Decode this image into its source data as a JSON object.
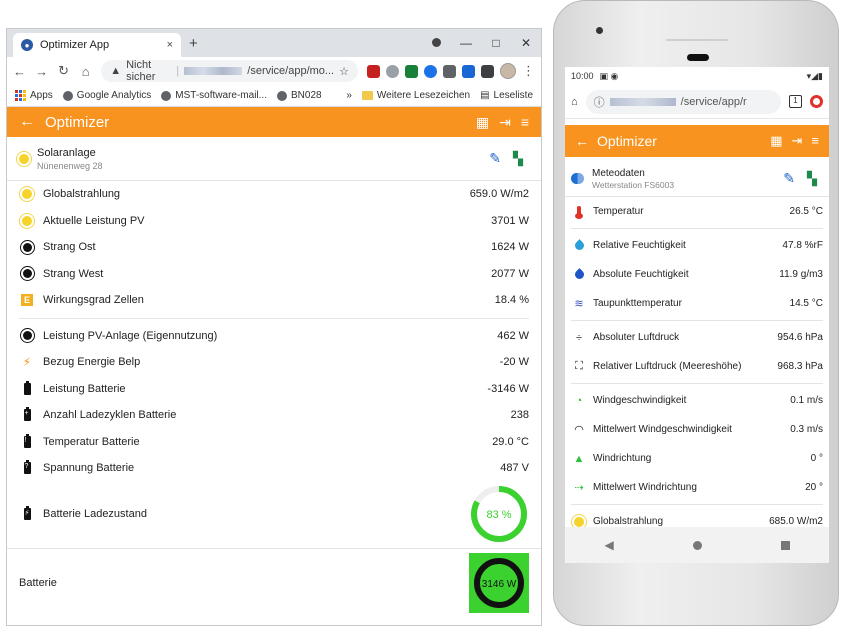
{
  "desktop": {
    "tab_title": "Optimizer App",
    "tab_close": "×",
    "new_tab": "+",
    "window_controls": [
      "—",
      "□",
      "✕"
    ],
    "url_warning": "Nicht sicher",
    "url_path": "/service/app/mo...",
    "bookmarks": {
      "apps": "Apps",
      "items": [
        "Google Analytics",
        "MST-software-mail...",
        "BN028"
      ],
      "more": "»",
      "other": "Weitere Lesezeichen",
      "reading": "Leseliste"
    },
    "appbar_title": "Optimizer",
    "panel_title": "Solaranlage",
    "panel_subtitle": "Nünenenweg 28",
    "rows_a": [
      {
        "icon": "sun-yellow-icon",
        "label": "Globalstrahlung",
        "value": "659.0 W/m2"
      },
      {
        "icon": "sun-yellow-icon",
        "label": "Aktuelle Leistung PV",
        "value": "3701  W"
      },
      {
        "icon": "sun-black-icon",
        "label": "Strang Ost",
        "value": "1624  W"
      },
      {
        "icon": "sun-black-icon",
        "label": "Strang West",
        "value": "2077  W"
      },
      {
        "icon": "efficiency-icon",
        "label": "Wirkungsgrad Zellen",
        "value": "18.4  %"
      }
    ],
    "rows_b": [
      {
        "icon": "sun-black-icon",
        "label": "Leistung PV-Anlage (Eigennutzung)",
        "value": "462  W"
      },
      {
        "icon": "lightning-icon",
        "label": "Bezug Energie Belp",
        "value": "-20  W"
      },
      {
        "icon": "battery-icon",
        "label": "Leistung Batterie",
        "value": "-3146  W"
      },
      {
        "icon": "battery-plus-icon",
        "label": "Anzahl Ladezyklen Batterie",
        "value": "238"
      },
      {
        "icon": "battery-alert-icon",
        "label": "Temperatur Batterie",
        "value": "29.0  °C"
      },
      {
        "icon": "battery-unknown-icon",
        "label": "Spannung Batterie",
        "value": "487  V"
      }
    ],
    "charge_label": "Batterie Ladezustand",
    "charge_text": "83 %",
    "charge_fraction": 0.83,
    "battery_label": "Batterie",
    "battery_text": "3146  W",
    "colors": {
      "accent": "#f7931e",
      "ring_green": "#3bd12e",
      "box_green": "#3bd12e"
    }
  },
  "phone": {
    "time": "10:00",
    "url_path": "/service/app/r",
    "tabs_count": "1",
    "appbar_title": "Optimizer",
    "panel_title": "Meteodaten",
    "panel_subtitle": "Wetterstation FS6003",
    "group1": [
      {
        "icon": "thermometer-icon",
        "label": "Temperatur",
        "value": "26.5  °C"
      }
    ],
    "group2": [
      {
        "icon": "humidity-icon",
        "label": "Relative Feuchtigkeit",
        "value": "47.8  %rF"
      },
      {
        "icon": "absolute-humidity-icon",
        "label": "Absolute Feuchtigkeit",
        "value": "11.9  g/m3"
      },
      {
        "icon": "dewpoint-icon",
        "label": "Taupunkttemperatur",
        "value": "14.5  °C"
      }
    ],
    "group3": [
      {
        "icon": "pressure-icon",
        "label": "Absoluter Luftdruck",
        "value": "954.6  hPa"
      },
      {
        "icon": "sea-level-pressure-icon",
        "label": "Relativer Luftdruck (Meereshöhe)",
        "value": "968.3  hPa"
      }
    ],
    "group4": [
      {
        "icon": "wind-speed-icon",
        "label": "Windgeschwindigkeit",
        "value": "0.1  m/s"
      },
      {
        "icon": "wind-speed-avg-icon",
        "label": "Mittelwert Windgeschwindigkeit",
        "value": "0.3  m/s"
      },
      {
        "icon": "wind-direction-icon",
        "label": "Windrichtung",
        "value": "0  °"
      },
      {
        "icon": "wind-direction-avg-icon",
        "label": "Mittelwert Windrichtung",
        "value": "20  °"
      }
    ],
    "group5": [
      {
        "icon": "sun-yellow-icon",
        "label": "Globalstrahlung",
        "value": "685.0  W/m2"
      }
    ]
  }
}
